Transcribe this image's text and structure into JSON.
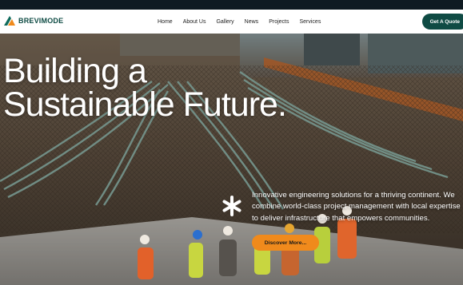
{
  "brand": {
    "name": "BREVIMODE"
  },
  "nav": {
    "items": [
      "Home",
      "About Us",
      "Gallery",
      "News",
      "Projects",
      "Services"
    ],
    "cta_label": "Get A Quote"
  },
  "hero": {
    "headline_line1": "Building a",
    "headline_line2": "Sustainable Future.",
    "description": "Innovative engineering solutions for a thriving continent. We combine world-class project management with local expertise to deliver infrastructure that empowers communities.",
    "button_label": "Discover More..."
  },
  "colors": {
    "brand_teal": "#0f4b44",
    "accent_orange": "#f08a1c"
  },
  "icons": [
    "brevimode-logo-icon",
    "asterisk-icon"
  ]
}
